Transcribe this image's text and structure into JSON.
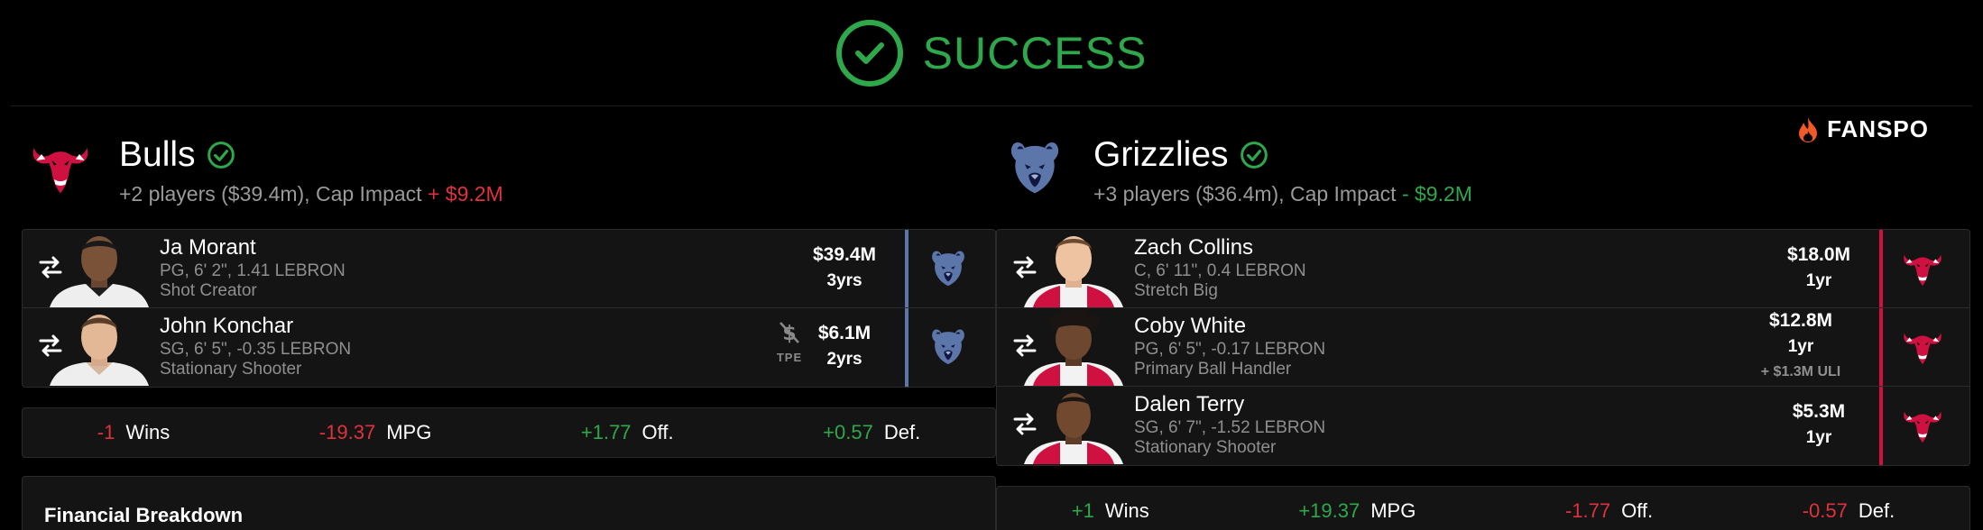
{
  "banner": {
    "title": "SUCCESS"
  },
  "brand": {
    "name": "FANSPO"
  },
  "colors": {
    "success": "#2ea84a",
    "negative": "#e0323c",
    "bulls": "#ce1141",
    "grizzlies": "#5d76a9"
  },
  "teams": [
    {
      "name": "Bulls",
      "summary_prefix": "+2 players ($39.4m), Cap Impact",
      "cap_impact": "+ $9.2M",
      "players": [
        {
          "name": "Ja Morant",
          "detail": "PG, 6' 2\", 1.41 LEBRON",
          "role": "Shot Creator",
          "salary": "$39.4M",
          "years": "3yrs",
          "from_team_icon": "grizzlies-logo"
        },
        {
          "name": "John Konchar",
          "detail": "SG, 6' 5\", -0.35 LEBRON",
          "role": "Stationary Shooter",
          "salary": "$6.1M",
          "years": "2yrs",
          "tpe_label": "TPE",
          "from_team_icon": "grizzlies-logo"
        }
      ],
      "impact": [
        {
          "value": "-1",
          "label": "Wins"
        },
        {
          "value": "-19.37",
          "label": "MPG"
        },
        {
          "value": "+1.77",
          "label": "Off."
        },
        {
          "value": "+0.57",
          "label": "Def."
        }
      ],
      "financial_title": "Financial Breakdown"
    },
    {
      "name": "Grizzlies",
      "summary_prefix": "+3 players ($36.4m), Cap Impact",
      "cap_impact": "- $9.2M",
      "players": [
        {
          "name": "Zach Collins",
          "detail": "C, 6' 11\", 0.4 LEBRON",
          "role": "Stretch Big",
          "salary": "$18.0M",
          "years": "1yr",
          "from_team_icon": "bulls-logo"
        },
        {
          "name": "Coby White",
          "detail": "PG, 6' 5\", -0.17 LEBRON",
          "role": "Primary Ball Handler",
          "salary": "$12.8M",
          "years": "1yr",
          "extra": "+ $1.3M ULI",
          "from_team_icon": "bulls-logo"
        },
        {
          "name": "Dalen Terry",
          "detail": "SG, 6' 7\", -1.52 LEBRON",
          "role": "Stationary Shooter",
          "salary": "$5.3M",
          "years": "1yr",
          "from_team_icon": "bulls-logo"
        }
      ],
      "impact": [
        {
          "value": "+1",
          "label": "Wins"
        },
        {
          "value": "+19.37",
          "label": "MPG"
        },
        {
          "value": "-1.77",
          "label": "Off."
        },
        {
          "value": "-0.57",
          "label": "Def."
        }
      ]
    }
  ]
}
